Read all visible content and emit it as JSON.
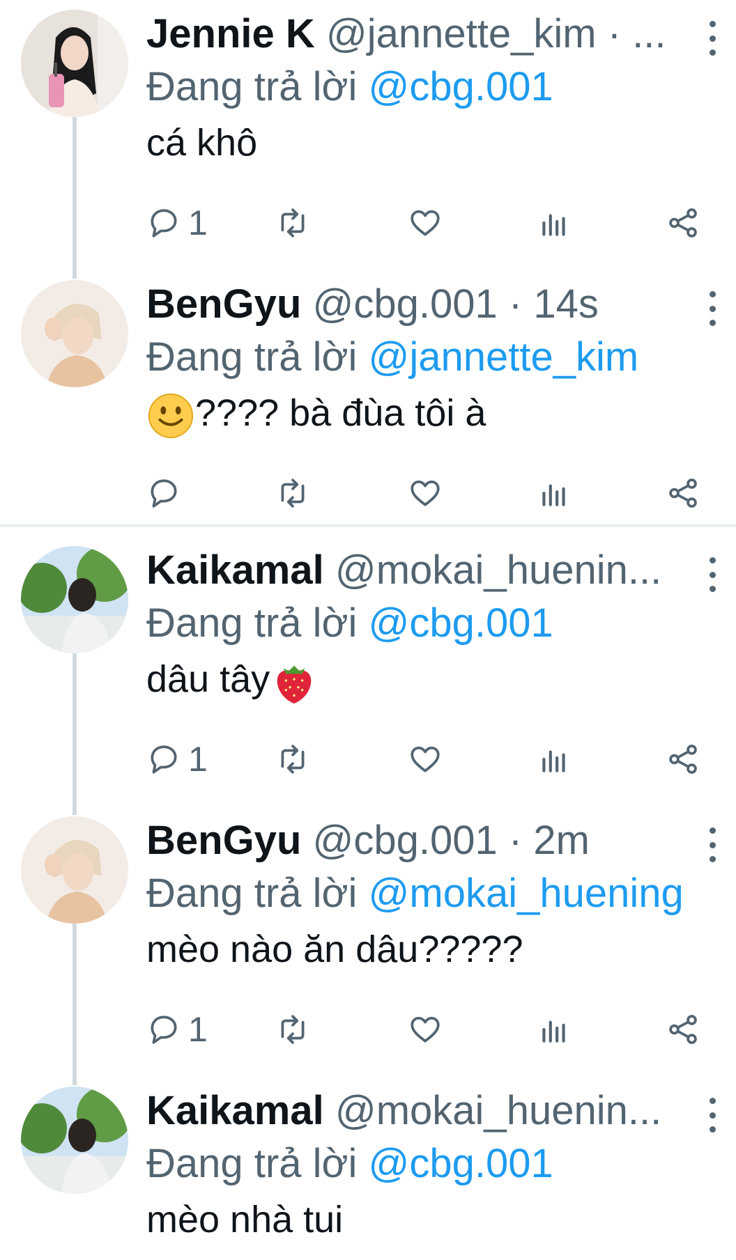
{
  "tweets": [
    {
      "name": "Jennie K",
      "handle": "@jannette_kim · ...",
      "replying_prefix": "Đang trả lời ",
      "replying_mention": "@cbg.001",
      "text": "cá khô",
      "reply_count": "1",
      "avatar_icon": "avatar-photo-pink-drink"
    },
    {
      "name": "BenGyu",
      "handle": "@cbg.001 · 14s",
      "replying_prefix": "Đang trả lời ",
      "replying_mention": "@jannette_kim",
      "text": "???? bà đùa tôi à",
      "leading_emoji": "slightly-smiling-face-emoji",
      "reply_count": "",
      "avatar_icon": "avatar-photo-blond"
    },
    {
      "name": "Kaikamal",
      "handle": "@mokai_huenin...",
      "replying_prefix": "Đang trả lời ",
      "replying_mention": "@cbg.001",
      "text": "dâu tây",
      "trailing_emoji": "strawberry-emoji",
      "reply_count": "1",
      "avatar_icon": "avatar-photo-trees"
    },
    {
      "name": "BenGyu",
      "handle": "@cbg.001 · 2m",
      "replying_prefix": "Đang trả lời ",
      "replying_mention": "@mokai_huening",
      "text": "mèo nào ăn dâu?????",
      "reply_count": "1",
      "avatar_icon": "avatar-photo-blond"
    },
    {
      "name": "Kaikamal",
      "handle": "@mokai_huenin...",
      "replying_prefix": "Đang trả lời ",
      "replying_mention": "@cbg.001",
      "text": "mèo nhà tui",
      "reply_count": "",
      "avatar_icon": "avatar-photo-trees"
    }
  ],
  "colors": {
    "link": "#1d9bf0",
    "secondary_text": "#536471",
    "primary_text": "#0f1419",
    "thread_line": "#cfd9de"
  }
}
